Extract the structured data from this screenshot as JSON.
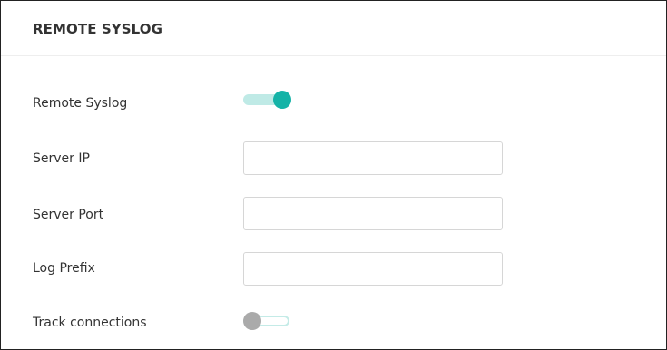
{
  "panel": {
    "title": "REMOTE SYSLOG"
  },
  "fields": {
    "remote_syslog": {
      "label": "Remote Syslog",
      "enabled": true
    },
    "server_ip": {
      "label": "Server IP",
      "value": ""
    },
    "server_port": {
      "label": "Server Port",
      "value": ""
    },
    "log_prefix": {
      "label": "Log Prefix",
      "value": ""
    },
    "track_connections": {
      "label": "Track connections",
      "enabled": false
    }
  },
  "colors": {
    "accent": "#15b3a7",
    "accent_light": "#bfeae6",
    "toggle_off_knob": "#aaaaaa"
  }
}
